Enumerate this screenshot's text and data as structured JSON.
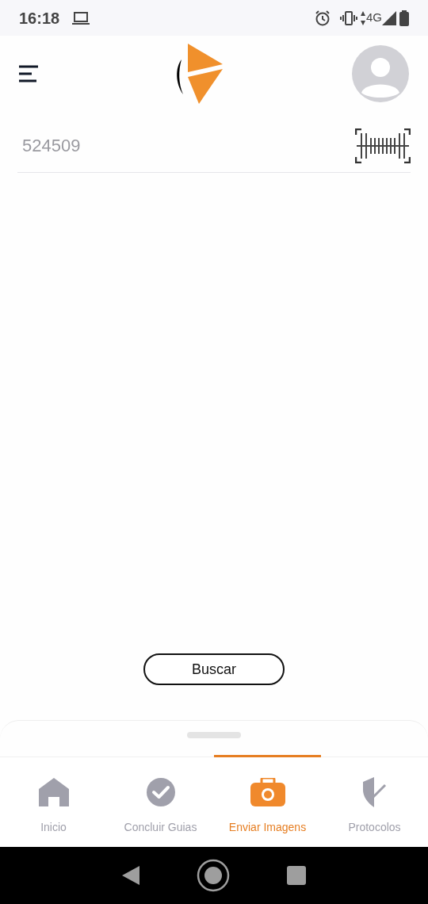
{
  "status_bar": {
    "time": "16:18",
    "network": "4G"
  },
  "search": {
    "value": "524509"
  },
  "buttons": [
    "Buscar"
  ],
  "tabs": [
    {
      "label": "Inicio",
      "kind": "home",
      "selected": false
    },
    {
      "label": "Concluir Guias",
      "kind": "check",
      "selected": false
    },
    {
      "label": "Enviar Imagens",
      "kind": "camera",
      "selected": true
    },
    {
      "label": "Protocolos",
      "kind": "shield",
      "selected": false
    }
  ]
}
